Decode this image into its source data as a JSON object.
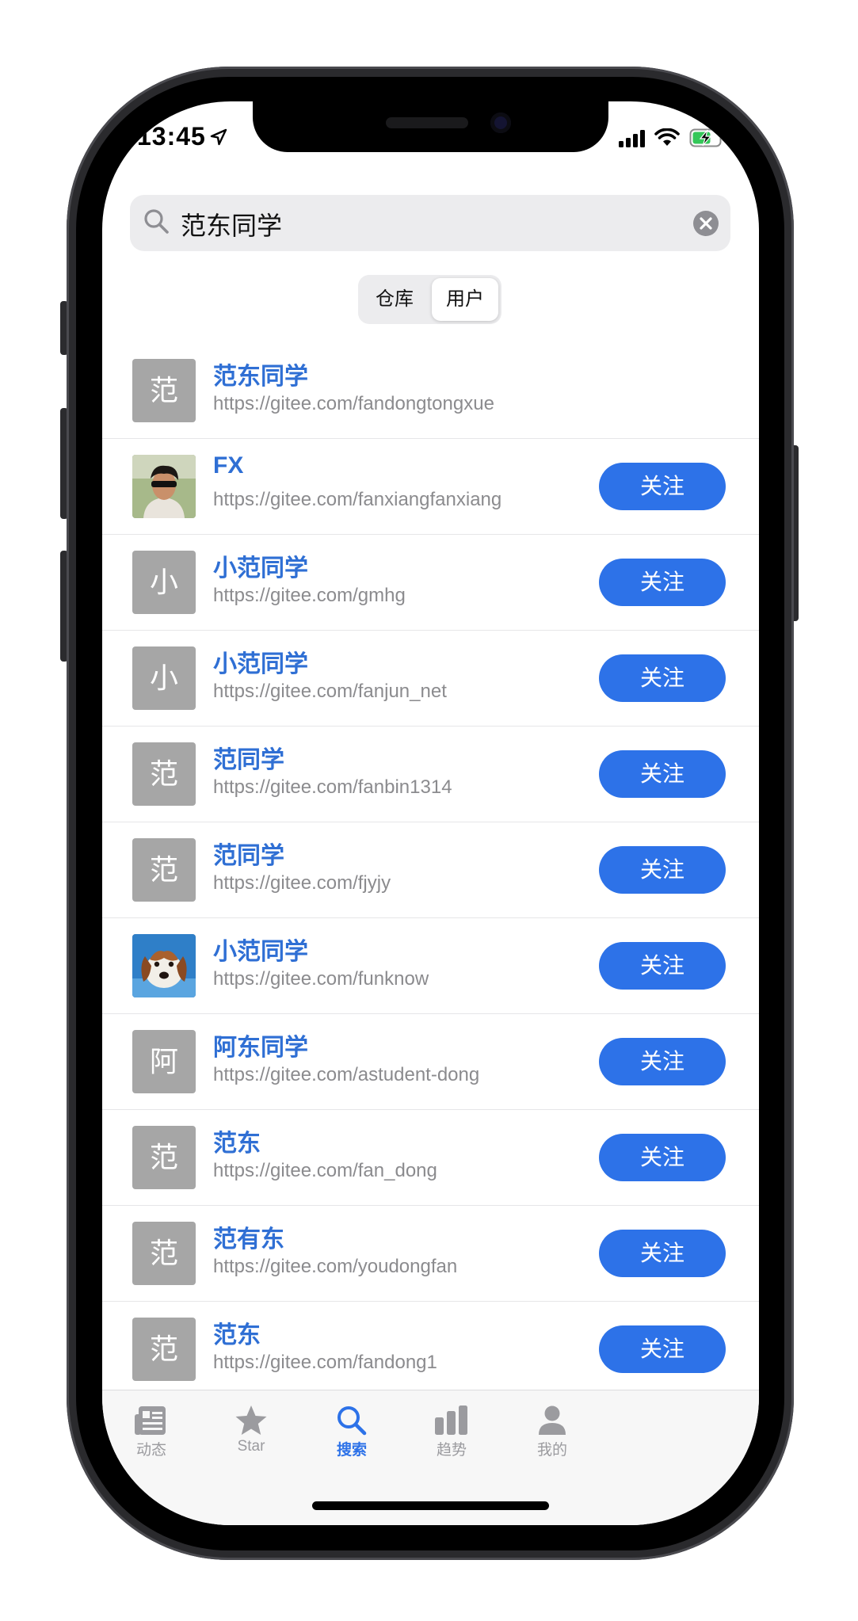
{
  "status_bar": {
    "time": "13:45"
  },
  "search": {
    "query": "范东同学"
  },
  "segments": {
    "repo": "仓库",
    "user": "用户",
    "active": "user"
  },
  "colors": {
    "accent": "#2d72e8",
    "link": "#2f6fd4",
    "placeholder_avatar": "#a6a6a6"
  },
  "users": [
    {
      "initial": "范",
      "name": "范东同学",
      "url": "https://gitee.com/fandongtongxue",
      "follow": ""
    },
    {
      "initial": "",
      "avatar": "photo-person",
      "name": "FX",
      "url": "https://gitee.com/fanxiangfanxiang",
      "follow": "关注"
    },
    {
      "initial": "小",
      "name": "小范同学",
      "url": "https://gitee.com/gmhg",
      "follow": "关注"
    },
    {
      "initial": "小",
      "name": "小范同学",
      "url": "https://gitee.com/fanjun_net",
      "follow": "关注"
    },
    {
      "initial": "范",
      "name": "范同学",
      "url": "https://gitee.com/fanbin1314",
      "follow": "关注"
    },
    {
      "initial": "范",
      "name": "范同学",
      "url": "https://gitee.com/fjyjy",
      "follow": "关注"
    },
    {
      "initial": "",
      "avatar": "photo-dog",
      "name": "小范同学",
      "url": "https://gitee.com/funknow",
      "follow": "关注"
    },
    {
      "initial": "阿",
      "name": "阿东同学",
      "url": "https://gitee.com/astudent-dong",
      "follow": "关注"
    },
    {
      "initial": "范",
      "name": "范东",
      "url": "https://gitee.com/fan_dong",
      "follow": "关注"
    },
    {
      "initial": "范",
      "name": "范有东",
      "url": "https://gitee.com/youdongfan",
      "follow": "关注"
    },
    {
      "initial": "范",
      "name": "范东",
      "url": "https://gitee.com/fandong1",
      "follow": "关注"
    }
  ],
  "tabs": [
    {
      "label": "动态",
      "icon": "news-icon"
    },
    {
      "label": "Star",
      "icon": "star-icon"
    },
    {
      "label": "搜索",
      "icon": "search-icon",
      "active": true
    },
    {
      "label": "趋势",
      "icon": "bar-chart-icon"
    },
    {
      "label": "我的",
      "icon": "person-icon"
    }
  ]
}
